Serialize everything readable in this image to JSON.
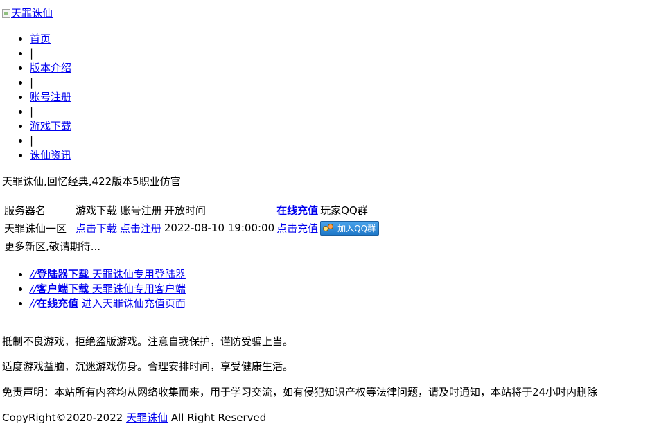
{
  "header": {
    "logo_alt": "天罪诛仙"
  },
  "nav": [
    {
      "label": "首页",
      "link": true
    },
    {
      "label": "|",
      "link": false
    },
    {
      "label": "版本介绍",
      "link": true
    },
    {
      "label": "|",
      "link": false
    },
    {
      "label": "账号注册",
      "link": true
    },
    {
      "label": "|",
      "link": false
    },
    {
      "label": "游戏下载",
      "link": true
    },
    {
      "label": "|",
      "link": false
    },
    {
      "label": "诛仙资讯",
      "link": true
    }
  ],
  "tagline": "天罪诛仙,回忆经典,422版本5职业仿官",
  "server_table": {
    "headers": {
      "name": "服务器名",
      "download": "游戏下载",
      "register": "账号注册",
      "open_time": "开放时间",
      "recharge": "在线充值",
      "qq_group": "玩家QQ群"
    },
    "rows": [
      {
        "name": "天罪诛仙一区",
        "download": "点击下载",
        "register": "点击注册",
        "open_time": "2022-08-10 19:00:00",
        "recharge": "点击充值",
        "qq_button": "加入QQ群"
      }
    ]
  },
  "more_text": "更多新区,敬请期待...",
  "links": [
    {
      "icon": "//",
      "title": "登陆器下载",
      "desc": "天罪诛仙专用登陆器"
    },
    {
      "icon": "//",
      "title": "客户端下载",
      "desc": "天罪诛仙专用客户端"
    },
    {
      "icon": "//",
      "title": "在线充值",
      "desc": "进入天罪诛仙充值页面"
    }
  ],
  "footer": {
    "line1": "抵制不良游戏，拒绝盗版游戏。注意自我保护，谨防受骗上当。",
    "line2": "适度游戏益脑，沉迷游戏伤身。合理安排时间，享受健康生活。",
    "line3": "免责声明：本站所有内容均从网络收集而来，用于学习交流，如有侵犯知识产权等法律问题，请及时通知，本站将于24小时内删除",
    "copyright_prefix": "CopyRight©2020-2022 ",
    "copyright_link": "天罪诛仙",
    "copyright_suffix": " All Right Reserved"
  },
  "colors": {
    "link": "#0000ee",
    "text": "#000000",
    "qq_button": "#1f78c8"
  }
}
